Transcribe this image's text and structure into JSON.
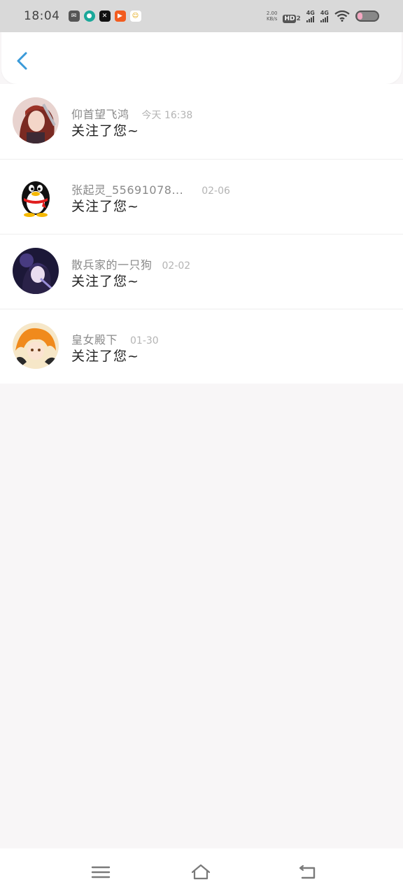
{
  "status_bar": {
    "time": "18:04",
    "net_speed_value": "2.00",
    "net_speed_unit": "KB/s",
    "hd_label": "HD",
    "hd_sub": "2",
    "signal1_label": "4G",
    "signal2_label": "4G",
    "app_icons": [
      "message-app-icon",
      "teal-app-icon",
      "capcut-icon",
      "kuaishou-icon",
      "emoji-app-icon"
    ]
  },
  "header": {
    "back_icon": "chevron-left-icon",
    "accent_color": "#3a9ad9"
  },
  "notifications": [
    {
      "name": "仰首望飞鸿",
      "time": "今天 16:38",
      "message": "关注了您~",
      "avatar": "anime-avatar-red-icon"
    },
    {
      "name": "张起灵_55691078...",
      "time": "02-06",
      "message": "关注了您~",
      "avatar": "qq-penguin-avatar-icon"
    },
    {
      "name": "散兵家的一只狗",
      "time": "02-02",
      "message": "关注了您~",
      "avatar": "anime-avatar-purple-icon"
    },
    {
      "name": "皇女殿下",
      "time": "01-30",
      "message": "关注了您~",
      "avatar": "anime-avatar-orange-icon"
    }
  ],
  "nav_bar": {
    "menu_icon": "menu-icon",
    "home_icon": "home-icon",
    "back_icon": "back-icon"
  }
}
